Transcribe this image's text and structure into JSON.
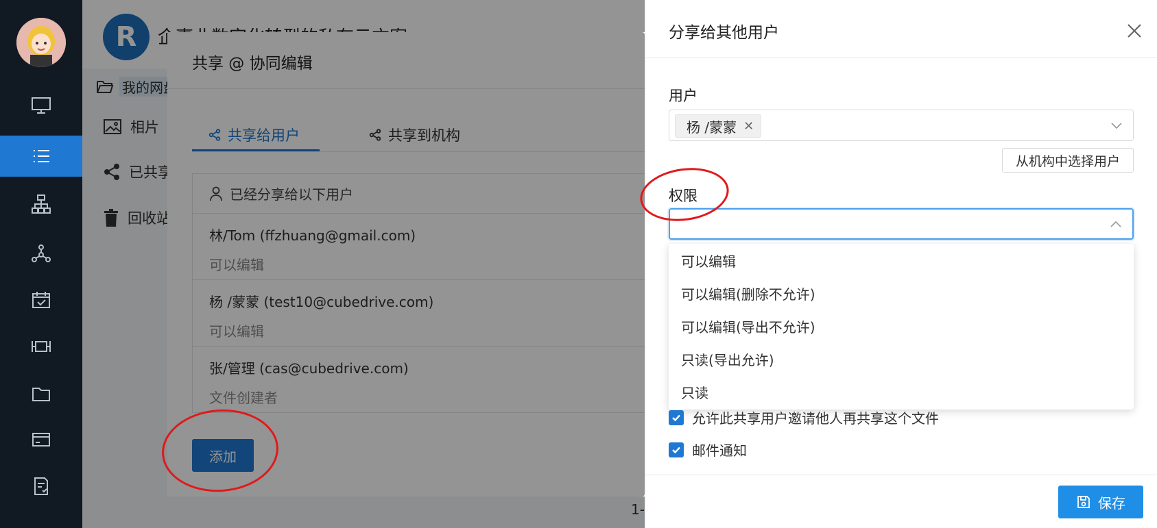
{
  "sidebar": {
    "items": [
      {
        "icon": "monitor-icon"
      },
      {
        "icon": "list-icon",
        "active": true
      },
      {
        "icon": "org-chart-icon"
      },
      {
        "icon": "network-icon"
      },
      {
        "icon": "calendar-check-icon"
      },
      {
        "icon": "resize-icon"
      },
      {
        "icon": "folder-icon"
      },
      {
        "icon": "card-icon"
      },
      {
        "icon": "document-icon"
      }
    ]
  },
  "background": {
    "logo_letter": "R",
    "app_title": "企事业数字化转型的私有云方案",
    "breadcrumb": "我的网盘",
    "nav": [
      {
        "label": "相片",
        "icon": "image-icon"
      },
      {
        "label": "已共享",
        "icon": "share-icon"
      },
      {
        "label": "回收站",
        "icon": "trash-icon"
      }
    ],
    "pager": "1-"
  },
  "share_dialog": {
    "title": "共享 @ 协同编辑",
    "tabs": [
      {
        "label": "共享给用户",
        "icon": "share-icon",
        "active": true
      },
      {
        "label": "共享到机构",
        "icon": "share-icon",
        "active": false
      }
    ],
    "shared_header": "已经分享给以下用户",
    "shared_users": [
      {
        "name": "林/Tom (ffzhuang@gmail.com)",
        "permission": "可以编辑"
      },
      {
        "name": "杨 /蒙蒙 (test10@cubedrive.com)",
        "permission": "可以编辑"
      },
      {
        "name": "张/管理 (cas@cubedrive.com)",
        "permission": "文件创建者"
      }
    ],
    "add_label": "添加"
  },
  "drawer": {
    "title": "分享给其他用户",
    "user_label": "用户",
    "selected_user": "杨 /蒙蒙",
    "org_button": "从机构中选择用户",
    "permission_label": "权限",
    "permission_value": "",
    "permission_options": [
      "可以编辑",
      "可以编辑(删除不允许)",
      "可以编辑(导出不允许)",
      "只读(导出允许)",
      "只读"
    ],
    "allow_reshare_label": "允许此共享用户邀请他人再共享这个文件",
    "allow_reshare_checked": true,
    "email_notify_label": "邮件通知",
    "email_notify_checked": true,
    "save_label": "保存"
  },
  "colors": {
    "accent": "#1f78d1",
    "sidebar_bg": "#111a22",
    "annotation_red": "#e0191b"
  }
}
